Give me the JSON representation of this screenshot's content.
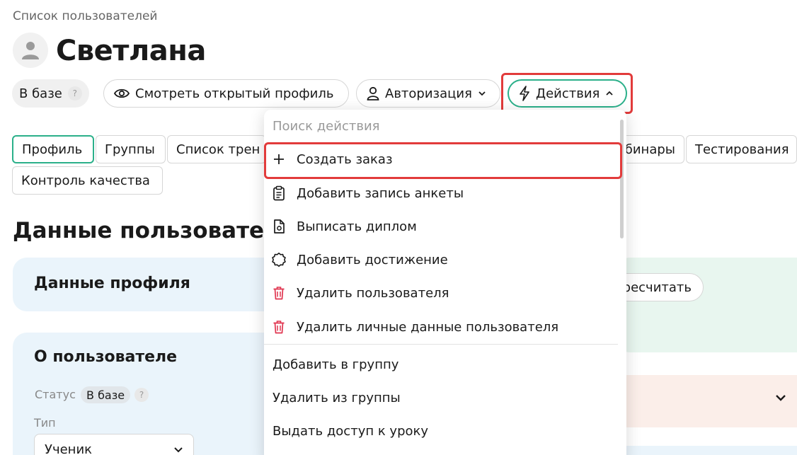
{
  "breadcrumb": "Список пользователей",
  "page_title": "Светлана",
  "header": {
    "status": "В базе",
    "help": "?",
    "view_profile": "Смотреть открытый профиль",
    "auth": "Авторизация",
    "actions": "Действия"
  },
  "tabs": [
    "Профиль",
    "Группы",
    "Список трен",
    "бинары",
    "Тестирования",
    "Контроль качества"
  ],
  "section_title": "Данные пользовател",
  "cards": {
    "profile_title": "Данные профиля",
    "recalc": "ресчитать",
    "about_title": "О пользователе",
    "status_label": "Статус",
    "status_value": "В базе",
    "type_label": "Тип",
    "type_value": "Ученик"
  },
  "dropdown": {
    "search_placeholder": "Поиск действия",
    "items": [
      {
        "label": "Создать заказ",
        "icon": "plus-icon"
      },
      {
        "label": "Добавить запись анкеты",
        "icon": "clipboard-icon"
      },
      {
        "label": "Выписать диплом",
        "icon": "document-icon"
      },
      {
        "label": "Добавить достижение",
        "icon": "badge-icon"
      },
      {
        "label": "Удалить пользователя",
        "icon": "trash-icon"
      },
      {
        "label": "Удалить личные данные пользователя",
        "icon": "trash-icon"
      }
    ],
    "plain_items": [
      "Добавить в группу",
      "Удалить из группы",
      "Выдать доступ к уроку"
    ]
  },
  "colors": {
    "accent": "#2bb08a",
    "highlight": "#e23b3b",
    "danger_icon": "#e0344f"
  }
}
